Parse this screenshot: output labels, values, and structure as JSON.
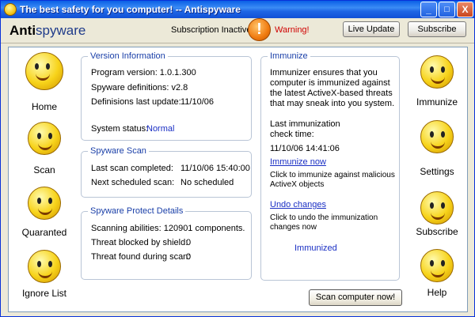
{
  "window": {
    "title": "The best safety for you computer! -- Antispyware",
    "controls": [
      "_",
      "□",
      "X"
    ]
  },
  "header": {
    "app_name_part1": "Anti",
    "app_name_part2": "spyware",
    "subscription_status": "Subscription Inactive",
    "warning_label": "Warning!",
    "warning_icon": "!",
    "live_update_label": "Live Update",
    "subscribe_label": "Subscribe"
  },
  "left_nav": [
    {
      "label": "Home",
      "icon": "smiley-computer-icon"
    },
    {
      "label": "Scan",
      "icon": "smiley-scan-icon"
    },
    {
      "label": "Quaranted",
      "icon": "smiley-quarantine-icon"
    },
    {
      "label": "Ignore List",
      "icon": "smiley-ignore-icon"
    }
  ],
  "right_nav": [
    {
      "label": "Immunize",
      "icon": "smiley-nurse-icon"
    },
    {
      "label": "Settings",
      "icon": "smiley-settings-icon"
    },
    {
      "label": "Subscribe",
      "icon": "smiley-subscribe-icon"
    },
    {
      "label": "Help",
      "icon": "smiley-help-icon"
    }
  ],
  "version_info": {
    "title": "Version Information",
    "program_version": "Program version:  1.0.1.300",
    "definitions": "Spyware definitions: v2.8",
    "last_update_label": "Definisions last update:",
    "last_update_value": "11/10/06",
    "status_label": "System status:",
    "status_value": "Normal"
  },
  "spyware_scan": {
    "title": "Spyware Scan",
    "last_scan_label": "Last scan completed:",
    "last_scan_value": "11/10/06 15:40:00",
    "next_scan_label": "Next scheduled scan:",
    "next_scan_value": "No scheduled"
  },
  "protect_details": {
    "title": "Spyware Protect Details",
    "scanning_abilities": "Scanning abilities: 120901 components.",
    "blocked_label": "Threat blocked by shield:",
    "blocked_value": "0",
    "found_label": "Threat found during scan:",
    "found_value": "0"
  },
  "immunize": {
    "title": "Immunize",
    "description_lines": [
      "Immunizer ensures that you",
      "computer is immunized against",
      "the latest ActiveX-based threats",
      "that may sneak into you system."
    ],
    "last_time_label_1": "Last immunization",
    "last_time_label_2": "check time:",
    "last_time_value": "11/10/06 14:41:06",
    "immunize_link": "Immunize now",
    "immunize_desc_1": "Click to immunize against malicious",
    "immunize_desc_2": "ActiveX objects",
    "undo_link": "Undo changes",
    "undo_desc_1": "Click to undo the immunization",
    "undo_desc_2": "changes now",
    "status_value": "Immunized"
  },
  "footer": {
    "scan_now_label": "Scan computer now!"
  }
}
